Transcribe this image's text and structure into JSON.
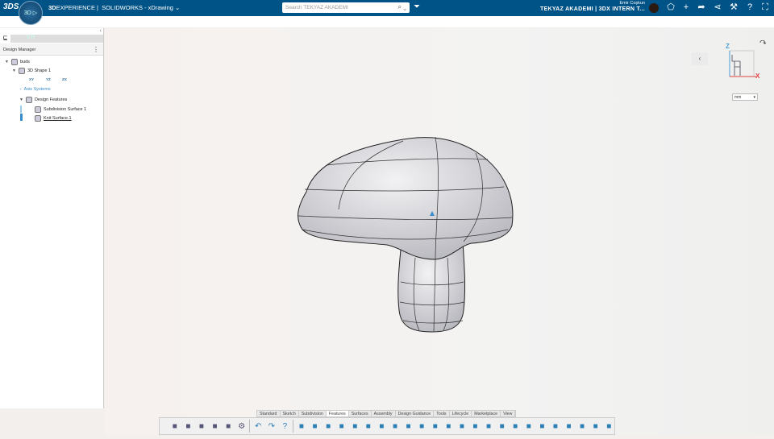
{
  "topbar": {
    "logo": "3DS",
    "compass_label": "3D ▷ V.R",
    "brand_bold": "3D",
    "brand_rest": "EXPERIENCE |",
    "app": "SOLIDWORKS - xDrawing",
    "search_placeholder": "Search TEKYAZ AKADEMI",
    "user_name": "Emir Coşkun",
    "tenant": "TEKYAZ AKADEMI | 3DX INTERN T...",
    "icons": [
      "tag-icon",
      "share-tag-icon",
      "add-icon",
      "forward-icon",
      "share-icon",
      "tools-icon",
      "help-icon",
      "fullscreen-icon"
    ]
  },
  "panel": {
    "title": "Design Manager",
    "tree": [
      {
        "label": "buds",
        "level": 0
      },
      {
        "label": "3D Shape 1",
        "level": 1
      },
      {
        "label": "XY",
        "level": 2
      },
      {
        "label": "YZ",
        "level": 2
      },
      {
        "label": "ZX",
        "level": 2
      },
      {
        "label": "Axis Systems",
        "level": 1
      },
      {
        "label": "Design Features",
        "level": 1
      },
      {
        "label": "Subdivision Surface 1",
        "level": 2
      },
      {
        "label": "Knit Surface.1",
        "level": 2
      }
    ]
  },
  "viewport": {
    "axis_z": "Z",
    "axis_x": "X",
    "unit": "mm",
    "colors": {
      "z": "#4a9fd8",
      "x": "#e04040"
    }
  },
  "ribbon": {
    "tabs": [
      "Standard",
      "Sketch",
      "Subdivision",
      "Features",
      "Surfaces",
      "Assembly",
      "Design Guidance",
      "Tools",
      "Lifecycle",
      "Marketplace",
      "View"
    ],
    "active_tab": "Features",
    "tools": [
      "open-icon",
      "save-icon",
      "save-as-icon",
      "export-icon",
      "print-icon",
      "settings-icon",
      "undo-icon",
      "redo-icon",
      "help-icon",
      "extrude-icon",
      "revolve-icon",
      "sweep-icon",
      "loft-icon",
      "boss-icon",
      "cut-icon",
      "shell-icon",
      "fillet-icon",
      "chamfer-icon",
      "draft-icon",
      "hole-icon",
      "mirror-icon",
      "pattern-icon",
      "rib-icon",
      "wrap-icon",
      "dome-icon",
      "split-icon",
      "combine-icon",
      "intersect-icon",
      "move-icon",
      "scale-icon",
      "thicken-icon",
      "surface-icon",
      "knit-icon"
    ]
  }
}
